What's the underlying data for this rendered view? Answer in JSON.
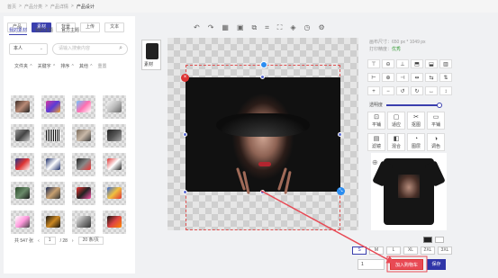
{
  "breadcrumb": [
    "首页",
    ">",
    "产品分类",
    ">",
    "产品详情",
    ">",
    "产品设计"
  ],
  "tabs": [
    "产品",
    "素材",
    "背景",
    "上传",
    "文本"
  ],
  "subtabs": [
    "我的素材",
    "我的主题",
    "官方主题"
  ],
  "filter": {
    "owner": "本人",
    "search_placeholder": "请输入搜索内容"
  },
  "filters": [
    "文件夹",
    "关键字",
    "排序",
    "其他",
    "重置"
  ],
  "pager": {
    "total": "共 547 张",
    "page": "1",
    "pages": "/ 28",
    "per": "20 条/页"
  },
  "side_thumb_label": "素材",
  "info": {
    "size_label": "画布尺寸：650 px * 1049 px",
    "dpi_label": "打印精度：",
    "dpi_value": "优秀"
  },
  "opacity_label": "透明度",
  "actions": [
    {
      "glyph": "⊡",
      "label": "平铺"
    },
    {
      "glyph": "▢",
      "label": "适应"
    },
    {
      "glyph": "✂",
      "label": "抠图"
    },
    {
      "glyph": "▭",
      "label": "平铺"
    },
    {
      "glyph": "▤",
      "label": "滤镜"
    },
    {
      "glyph": "◧",
      "label": "混合"
    },
    {
      "glyph": "◔",
      "label": "图层"
    },
    {
      "glyph": "◑",
      "label": "调色"
    }
  ],
  "sizes": [
    "S",
    "M",
    "L",
    "XL",
    "2XL",
    "3XL"
  ],
  "quantity": "1",
  "cart_label": "加入购物车",
  "save_label": "保存",
  "colors": {
    "accent": "#3a3fae",
    "cart": "#e84a55",
    "save": "#2f35a8"
  }
}
